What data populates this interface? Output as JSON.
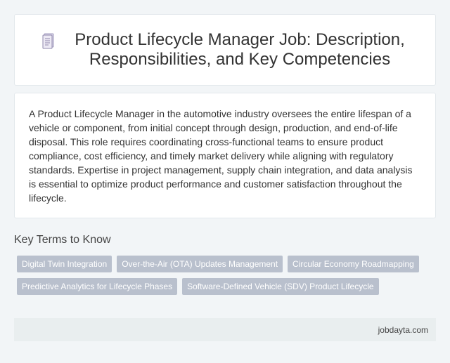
{
  "header": {
    "icon": "document-icon",
    "title": "Product Lifecycle Manager Job: Description, Responsibilities, and Key Competencies"
  },
  "description": {
    "text": "A Product Lifecycle Manager in the automotive industry oversees the entire lifespan of a vehicle or component, from initial concept through design, production, and end-of-life disposal. This role requires coordinating cross-functional teams to ensure product compliance, cost efficiency, and timely market delivery while aligning with regulatory standards. Expertise in project management, supply chain integration, and data analysis is essential to optimize product performance and customer satisfaction throughout the lifecycle."
  },
  "key_terms": {
    "heading": "Key Terms to Know",
    "tags": [
      "Digital Twin Integration",
      "Over-the-Air (OTA) Updates Management",
      "Circular Economy Roadmapping",
      "Predictive Analytics for Lifecycle Phases",
      "Software-Defined Vehicle (SDV) Product Lifecycle"
    ]
  },
  "footer": {
    "site": "jobdayta.com"
  },
  "colors": {
    "background": "#f2f5f7",
    "card": "#ffffff",
    "tag": "#b9c0cd",
    "footer": "#e9eeef"
  }
}
